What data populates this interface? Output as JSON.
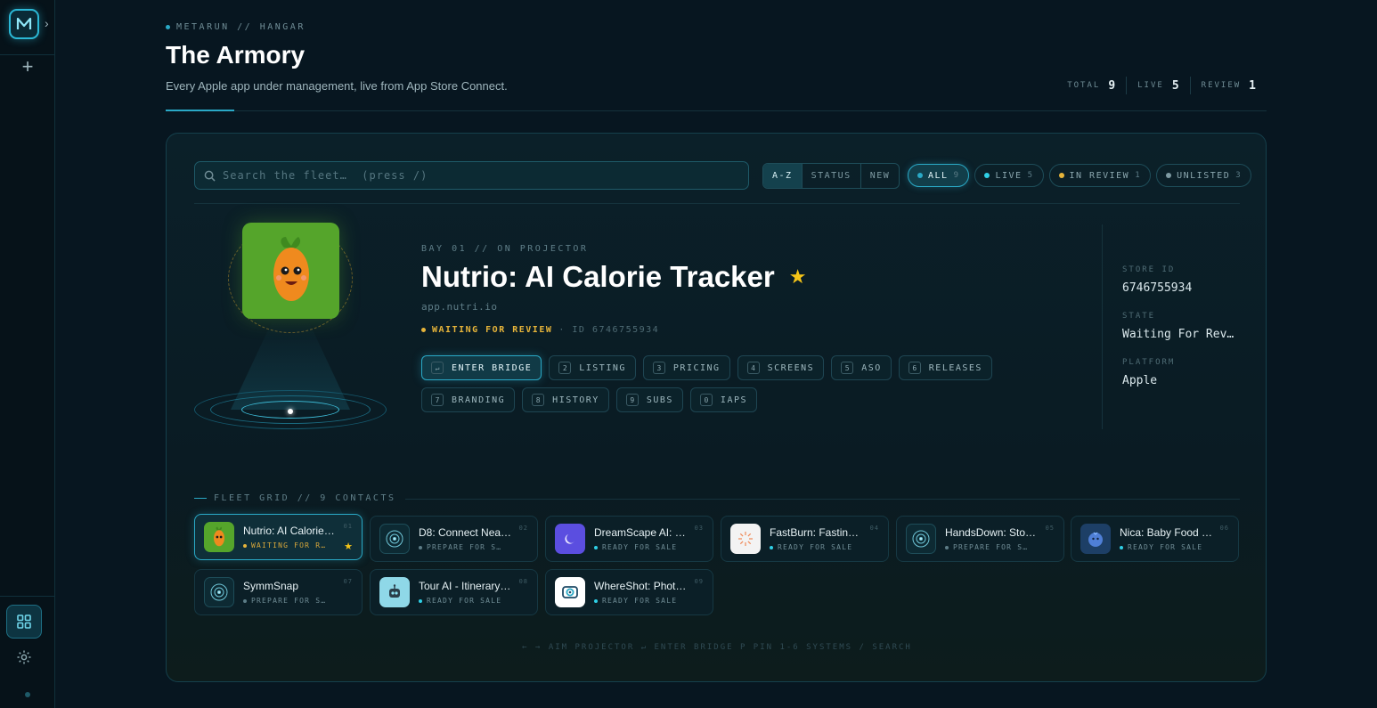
{
  "header": {
    "breadcrumb": "METARUN // HANGAR",
    "title": "The Armory",
    "subtitle": "Every Apple app under management, live from App Store Connect.",
    "stats": [
      {
        "label": "TOTAL",
        "value": "9"
      },
      {
        "label": "LIVE",
        "value": "5"
      },
      {
        "label": "REVIEW",
        "value": "1"
      }
    ]
  },
  "toolbar": {
    "search_placeholder": "Search the fleet…  (press /)",
    "sort": [
      "A-Z",
      "STATUS",
      "NEW"
    ],
    "filters": [
      {
        "label": "ALL",
        "count": "9",
        "color": "#2aa9c6"
      },
      {
        "label": "LIVE",
        "count": "5",
        "color": "#2fd0e6"
      },
      {
        "label": "IN REVIEW",
        "count": "1",
        "color": "#e6b43a"
      },
      {
        "label": "UNLISTED",
        "count": "3",
        "color": "#7e9aa2"
      }
    ]
  },
  "projector": {
    "bay": "BAY 01 // ON PROJECTOR",
    "name": "Nutrio: AI Calorie Tracker",
    "bundle": "app.nutri.io",
    "status": "WAITING FOR REVIEW",
    "id_text": "· ID 6746755934",
    "actions": [
      {
        "key": "↵",
        "label": "ENTER BRIDGE"
      },
      {
        "key": "2",
        "label": "LISTING"
      },
      {
        "key": "3",
        "label": "PRICING"
      },
      {
        "key": "4",
        "label": "SCREENS"
      },
      {
        "key": "5",
        "label": "ASO"
      },
      {
        "key": "6",
        "label": "RELEASES"
      },
      {
        "key": "7",
        "label": "BRANDING"
      },
      {
        "key": "8",
        "label": "HISTORY"
      },
      {
        "key": "9",
        "label": "SUBS"
      },
      {
        "key": "0",
        "label": "IAPS"
      }
    ],
    "meta": [
      {
        "label": "STORE ID",
        "value": "6746755934"
      },
      {
        "label": "STATE",
        "value": "Waiting For Rev…"
      },
      {
        "label": "PLATFORM",
        "value": "Apple"
      }
    ]
  },
  "fleet": {
    "title": "FLEET GRID // 9 CONTACTS",
    "tiles": [
      {
        "name": "Nutrio: AI Calorie…",
        "status": "WAITING FOR R…",
        "num": "01",
        "icon": "carrot-icon",
        "bg": "#55a52b",
        "dot": "#e6b43a"
      },
      {
        "name": "D8: Connect Nea…",
        "status": "PREPARE FOR S…",
        "num": "02",
        "icon": "placeholder-icon",
        "bg": "#0d2a33",
        "dot": "#5c7c86"
      },
      {
        "name": "DreamScape AI: …",
        "status": "READY FOR SALE",
        "num": "03",
        "icon": "moon-icon",
        "bg": "#5b4ee0",
        "dot": "#2fd0e6"
      },
      {
        "name": "FastBurn: Fastin…",
        "status": "READY FOR SALE",
        "num": "04",
        "icon": "burst-icon",
        "bg": "#f3f3f3",
        "dot": "#2fd0e6"
      },
      {
        "name": "HandsDown: Sto…",
        "status": "PREPARE FOR S…",
        "num": "05",
        "icon": "placeholder-icon",
        "bg": "#0d2a33",
        "dot": "#5c7c86"
      },
      {
        "name": "Nica: Baby Food …",
        "status": "READY FOR SALE",
        "num": "06",
        "icon": "blueberry-icon",
        "bg": "#1d3f66",
        "dot": "#2fd0e6"
      },
      {
        "name": "SymmSnap",
        "status": "PREPARE FOR S…",
        "num": "07",
        "icon": "placeholder-icon",
        "bg": "#0d2a33",
        "dot": "#5c7c86"
      },
      {
        "name": "Tour AI - Itinerary…",
        "status": "READY FOR SALE",
        "num": "08",
        "icon": "robot-icon",
        "bg": "#8fd8e8",
        "dot": "#2fd0e6"
      },
      {
        "name": "WhereShot: Phot…",
        "status": "READY FOR SALE",
        "num": "09",
        "icon": "camera-pin-icon",
        "bg": "#ffffff",
        "dot": "#2fd0e6"
      }
    ]
  },
  "hints": "←  → AIM PROJECTOR    ↵ ENTER BRIDGE    P PIN    1-6 SYSTEMS    / SEARCH"
}
